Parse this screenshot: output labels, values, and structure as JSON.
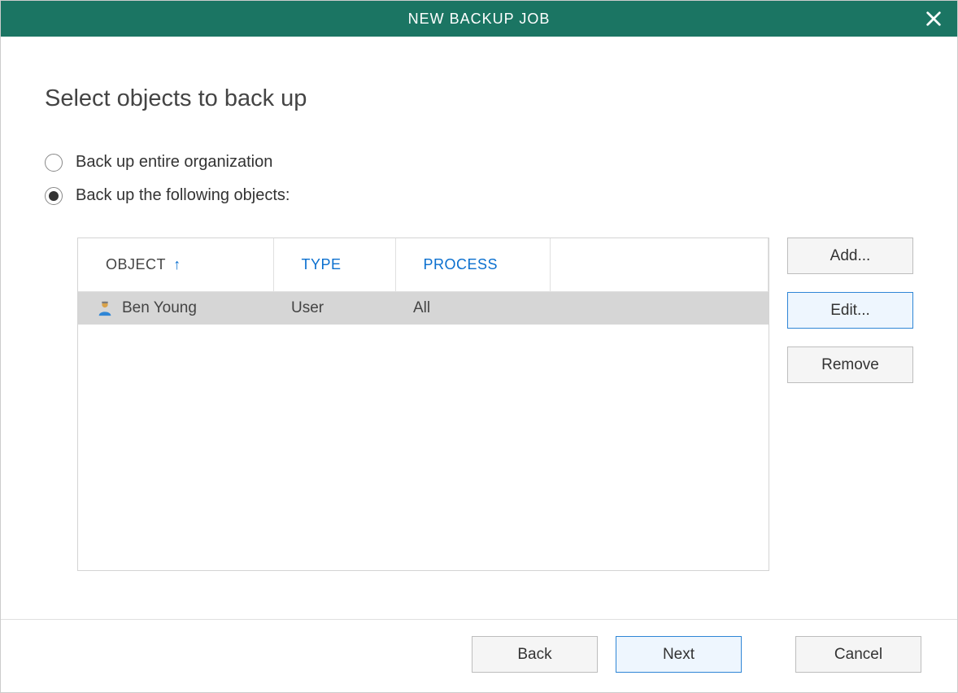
{
  "title": "NEW BACKUP JOB",
  "heading": "Select objects to back up",
  "options": {
    "entire_org": "Back up entire organization",
    "following": "Back up the following objects:"
  },
  "selected_option": "following",
  "table": {
    "headers": {
      "object": "OBJECT",
      "type": "TYPE",
      "process": "PROCESS"
    },
    "sort_indicator": "↑",
    "rows": [
      {
        "object": "Ben Young",
        "type": "User",
        "process": "All",
        "selected": true
      }
    ]
  },
  "side_buttons": {
    "add": "Add...",
    "edit": "Edit...",
    "remove": "Remove"
  },
  "nav": {
    "back": "Back",
    "next": "Next",
    "cancel": "Cancel"
  }
}
